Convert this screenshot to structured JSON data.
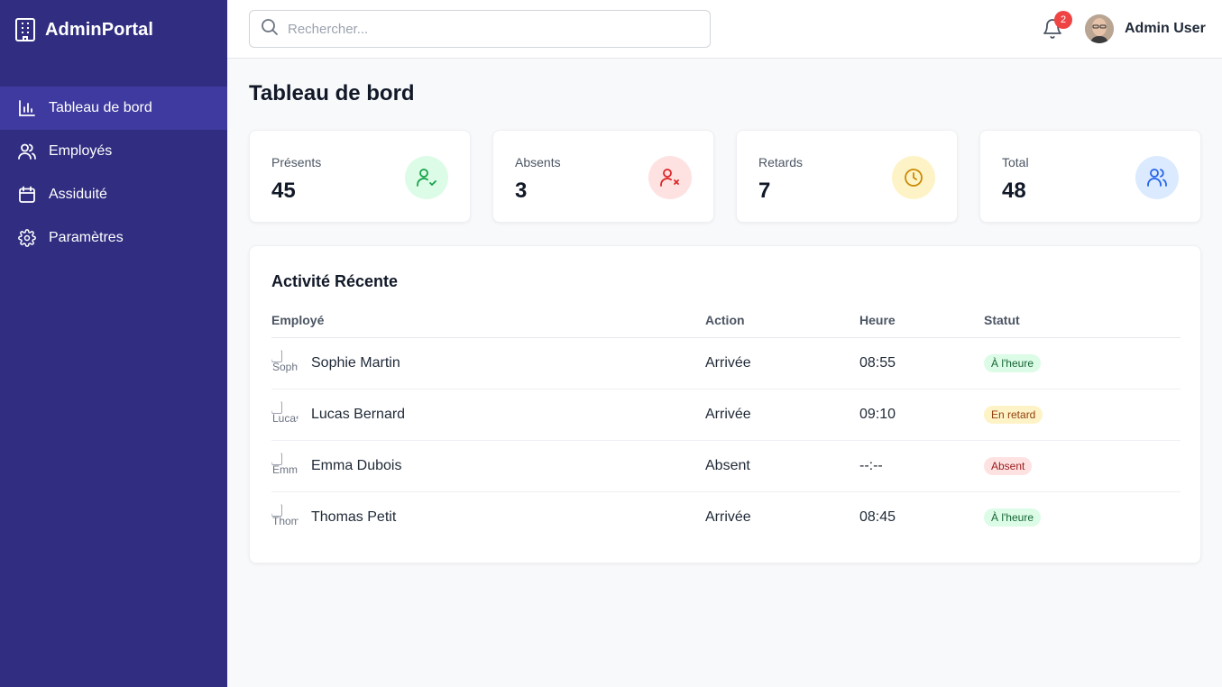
{
  "brand": {
    "name": "AdminPortal"
  },
  "nav": [
    {
      "label": "Tableau de bord",
      "icon": "bar-chart-icon",
      "active": true
    },
    {
      "label": "Employés",
      "icon": "users-icon",
      "active": false
    },
    {
      "label": "Assiduité",
      "icon": "calendar-icon",
      "active": false
    },
    {
      "label": "Paramètres",
      "icon": "gear-icon",
      "active": false
    }
  ],
  "header": {
    "search_placeholder": "Rechercher...",
    "notifications_count": "2",
    "user_name": "Admin User"
  },
  "page": {
    "title": "Tableau de bord"
  },
  "stats": [
    {
      "label": "Présents",
      "value": "45",
      "icon": "user-check-icon",
      "color": "#16a34a",
      "bg": "#dcfce7"
    },
    {
      "label": "Absents",
      "value": "3",
      "icon": "user-x-icon",
      "color": "#dc2626",
      "bg": "#fee2e2"
    },
    {
      "label": "Retards",
      "value": "7",
      "icon": "clock-icon",
      "color": "#ca8a04",
      "bg": "#fef3c7"
    },
    {
      "label": "Total",
      "value": "48",
      "icon": "users-icon",
      "color": "#2563eb",
      "bg": "#dbeafe"
    }
  ],
  "activity": {
    "title": "Activité Récente",
    "columns": [
      "Employé",
      "Action",
      "Heure",
      "Statut"
    ],
    "rows": [
      {
        "name": "Sophie Martin",
        "alt": "Sophie",
        "action": "Arrivée",
        "time": "08:55",
        "status": "À l'heure",
        "tone": "green"
      },
      {
        "name": "Lucas Bernard",
        "alt": "Lucas",
        "action": "Arrivée",
        "time": "09:10",
        "status": "En retard",
        "tone": "yellow"
      },
      {
        "name": "Emma Dubois",
        "alt": "Emma",
        "action": "Absent",
        "time": "--:--",
        "status": "Absent",
        "tone": "red"
      },
      {
        "name": "Thomas Petit",
        "alt": "Thomas",
        "action": "Arrivée",
        "time": "08:45",
        "status": "À l'heure",
        "tone": "green"
      }
    ]
  }
}
